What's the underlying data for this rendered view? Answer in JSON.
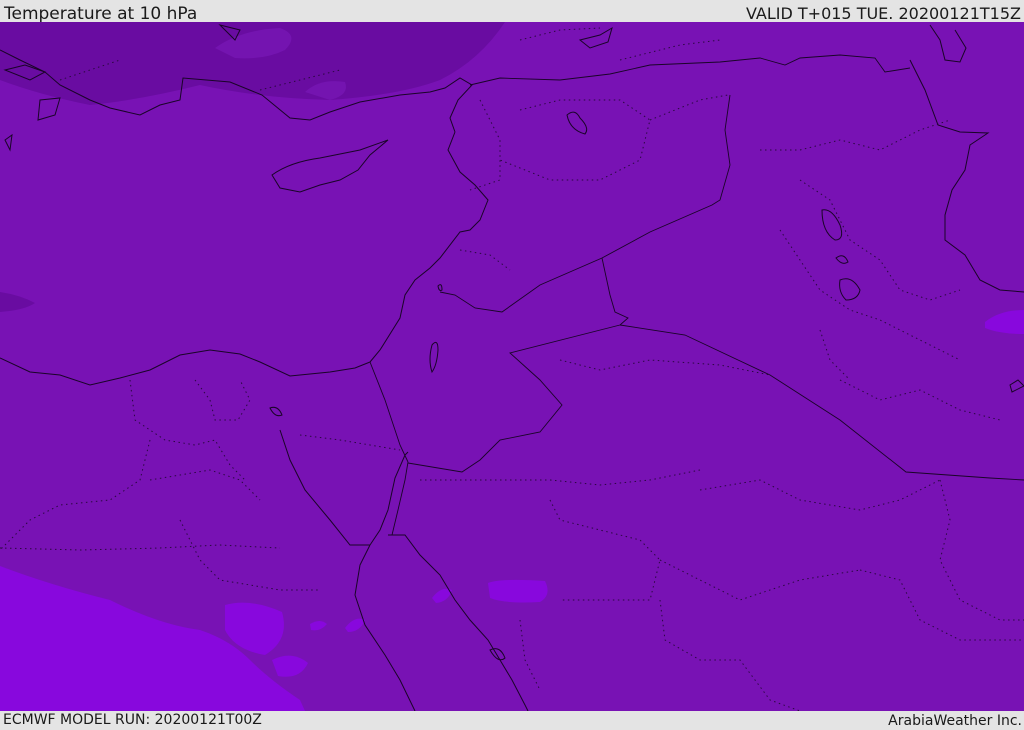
{
  "header": {
    "title": "Temperature at 10 hPa",
    "valid": "VALID T+015 TUE. 20200121T15Z"
  },
  "footer": {
    "model_run": "ECMWF MODEL RUN: 20200121T00Z",
    "credit": "ArabiaWeather Inc."
  },
  "map": {
    "field": "Temperature at 10 hPa",
    "colors": {
      "main_band": "#7812b4",
      "cold_band": "#690ca1",
      "warm_band": "#8808dd",
      "coastline": "#1a0428"
    }
  }
}
